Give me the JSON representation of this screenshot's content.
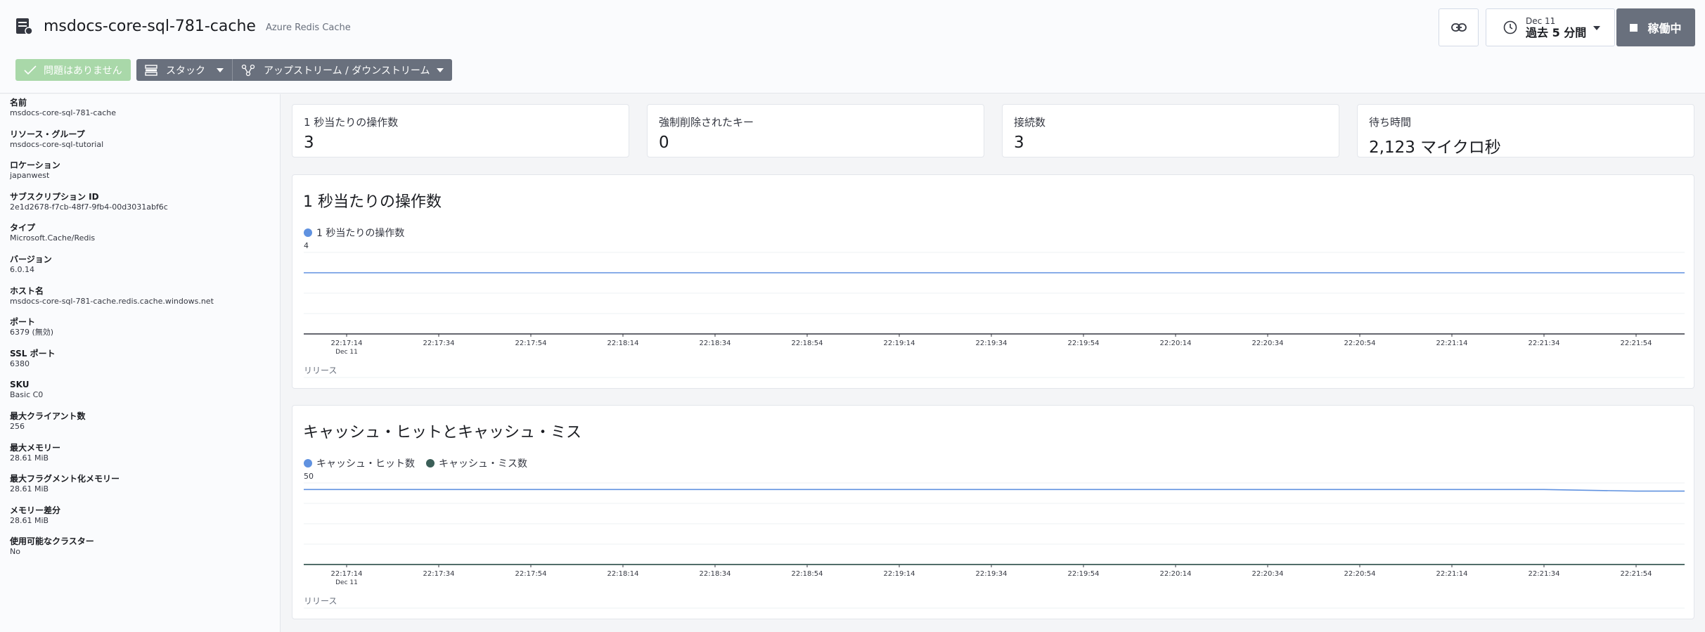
{
  "header": {
    "title": "msdocs-core-sql-781-cache",
    "subtitle": "Azure Redis Cache",
    "status_button": "問題はありません",
    "stack_button": "スタック",
    "upstream_button": "アップストリーム / ダウンストリーム",
    "time_date": "Dec 11",
    "time_range": "過去 5 分間",
    "run_button": "稼働中"
  },
  "sidebar": {
    "items": [
      {
        "label": "名前",
        "value": "msdocs-core-sql-781-cache"
      },
      {
        "label": "リソース・グループ",
        "value": "msdocs-core-sql-tutorial"
      },
      {
        "label": "ロケーション",
        "value": "japanwest"
      },
      {
        "label": "サブスクリプション ID",
        "value": "2e1d2678-f7cb-48f7-9fb4-00d3031abf6c"
      },
      {
        "label": "タイプ",
        "value": "Microsoft.Cache/Redis"
      },
      {
        "label": "バージョン",
        "value": "6.0.14"
      },
      {
        "label": "ホスト名",
        "value": "msdocs-core-sql-781-cache.redis.cache.windows.net"
      },
      {
        "label": "ポート",
        "value": "6379 (無効)"
      },
      {
        "label": "SSL ポート",
        "value": "6380"
      },
      {
        "label": "SKU",
        "value": "Basic C0"
      },
      {
        "label": "最大クライアント数",
        "value": "256"
      },
      {
        "label": "最大メモリー",
        "value": "28.61 MiB"
      },
      {
        "label": "最大フラグメント化メモリー",
        "value": "28.61 MiB"
      },
      {
        "label": "メモリー差分",
        "value": "28.61 MiB"
      },
      {
        "label": "使用可能なクラスター",
        "value": "No"
      }
    ]
  },
  "stats": [
    {
      "label": "1 秒当たりの操作数",
      "value": "3"
    },
    {
      "label": "強制削除されたキー",
      "value": "0"
    },
    {
      "label": "接続数",
      "value": "3"
    },
    {
      "label": "待ち時間",
      "value": "2,123 マイクロ秒"
    }
  ],
  "chart_data": [
    {
      "type": "line",
      "title": "1 秒当たりの操作数",
      "x": [
        "22:17:14",
        "22:17:34",
        "22:17:54",
        "22:18:14",
        "22:18:34",
        "22:18:54",
        "22:19:14",
        "22:19:34",
        "22:19:54",
        "22:20:14",
        "22:20:34",
        "22:20:54",
        "22:21:14",
        "22:21:34",
        "22:21:54"
      ],
      "x_sublabel": "Dec 11",
      "ytick": "4",
      "ylim": [
        0,
        4
      ],
      "grid": true,
      "legend_position": "top-left",
      "series": [
        {
          "name": "1 秒当たりの操作数",
          "color": "#6092e0",
          "values": [
            3,
            3,
            3,
            3,
            3,
            3,
            3,
            3,
            3,
            3,
            3,
            3,
            3,
            3,
            3
          ]
        }
      ],
      "footer_label": "リリース"
    },
    {
      "type": "line",
      "title": "キャッシュ・ヒットとキャッシュ・ミス",
      "x": [
        "22:17:14",
        "22:17:34",
        "22:17:54",
        "22:18:14",
        "22:18:34",
        "22:18:54",
        "22:19:14",
        "22:19:34",
        "22:19:54",
        "22:20:14",
        "22:20:34",
        "22:20:54",
        "22:21:14",
        "22:21:34",
        "22:21:54"
      ],
      "x_sublabel": "Dec 11",
      "ytick": "50",
      "ylim": [
        0,
        50
      ],
      "grid": true,
      "legend_position": "top-left",
      "series": [
        {
          "name": "キャッシュ・ヒット数",
          "color": "#6092e0",
          "values": [
            46,
            46,
            46,
            46,
            46,
            46,
            46,
            46,
            46,
            46,
            46,
            46,
            46,
            46,
            45
          ]
        },
        {
          "name": "キャッシュ・ミス数",
          "color": "#3b5f58",
          "values": [
            0,
            0,
            0,
            0,
            0,
            0,
            0,
            0,
            0,
            0,
            0,
            0,
            0,
            0,
            0
          ]
        }
      ],
      "footer_label": "リリース"
    }
  ]
}
